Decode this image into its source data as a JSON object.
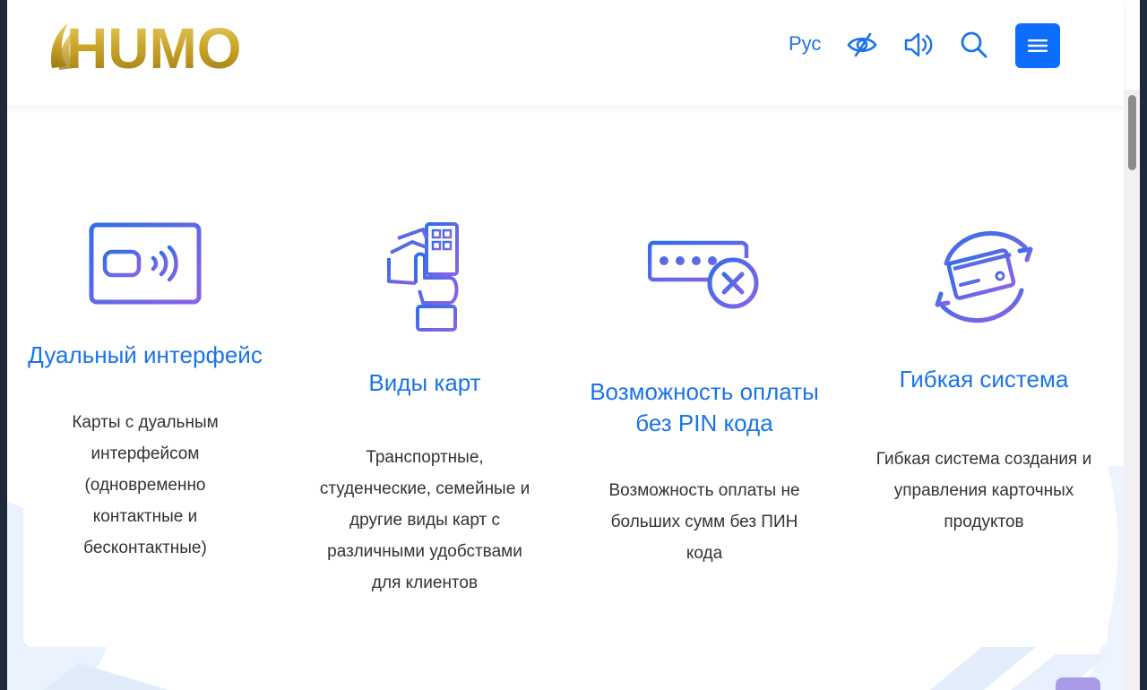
{
  "header": {
    "logo_text": "HUMO",
    "language": "Рус",
    "icons": [
      "eye-slash-icon",
      "speaker-icon",
      "search-icon"
    ],
    "menu_icon": "hamburger-menu-icon"
  },
  "features": [
    {
      "icon": "contactless-card-icon",
      "title": "Дуальный интерфейс",
      "description": "Карты с дуальным интерфейсом (одновременно контактные и бесконтактные)"
    },
    {
      "icon": "hand-holding-cards-icon",
      "title": "Виды карт",
      "description": "Транспортные, студенческие, семейные и другие виды карт с различными удобствами для клиентов"
    },
    {
      "icon": "pin-cancel-icon",
      "title": "Возможность оплаты без PIN кода",
      "description": "Возможность оплаты не больших сумм без ПИН кода"
    },
    {
      "icon": "card-sync-icon",
      "title": "Гибкая система",
      "description": "Гибкая система создания и управления карточных продуктов"
    }
  ],
  "colors": {
    "accent": "#1a73e8",
    "menu_button": "#0d6efd",
    "logo_gold": "#c9a227",
    "icon_gradient_start": "#2f6fe8",
    "icon_gradient_end": "#8a63e6"
  }
}
